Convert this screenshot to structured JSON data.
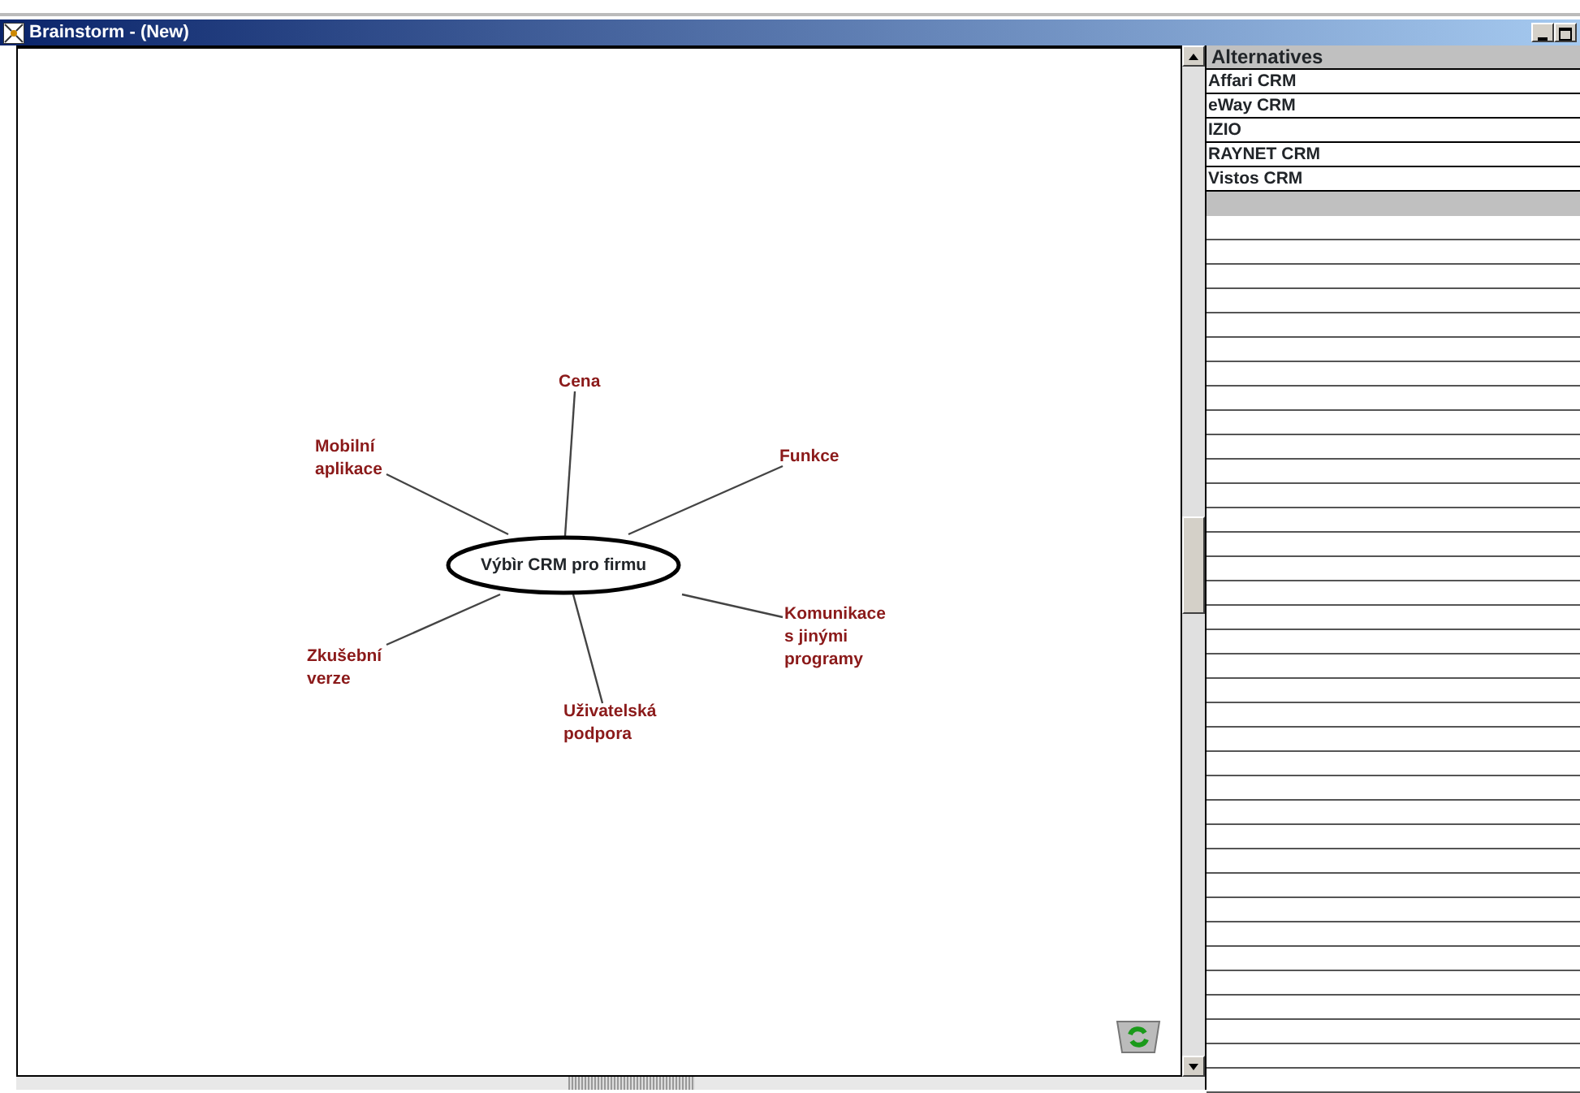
{
  "window": {
    "title": "Brainstorm - (New)"
  },
  "mind_map": {
    "central_topic": "Výbìr CRM pro firmu",
    "branches": [
      {
        "label": "Cena"
      },
      {
        "label": "Funkce"
      },
      {
        "label": "Mobilní\naplikace"
      },
      {
        "label": "Komunikace\ns jinými\nprogramy"
      },
      {
        "label": "Zkušební\nverze"
      },
      {
        "label": "Uživatelská\npodpora"
      }
    ]
  },
  "alternatives": {
    "header": "Alternatives",
    "items": [
      "Affari CRM",
      "eWay CRM",
      "IZIO",
      "RAYNET CRM",
      "Vistos CRM"
    ]
  }
}
